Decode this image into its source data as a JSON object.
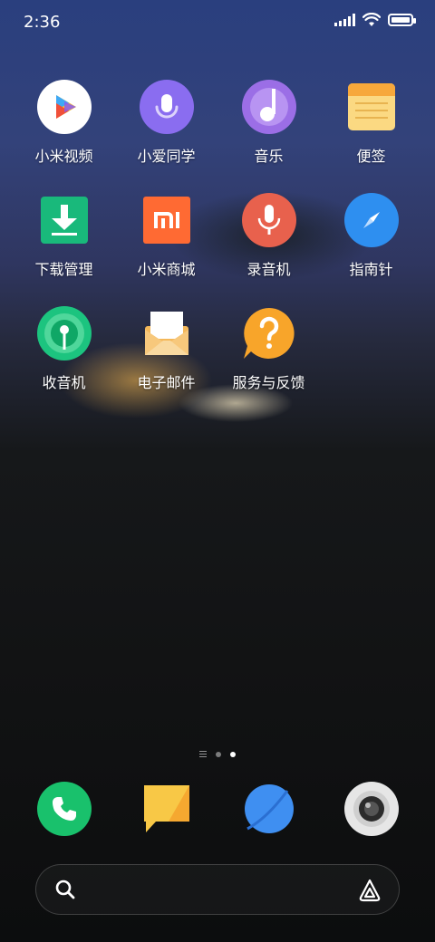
{
  "status_bar": {
    "time": "2:36"
  },
  "apps": [
    {
      "name": "app-mi-video",
      "label": "小米视频",
      "icon": "play-triangle-icon"
    },
    {
      "name": "app-xiaoai",
      "label": "小爱同学",
      "icon": "xiaoai-mic-icon"
    },
    {
      "name": "app-music",
      "label": "音乐",
      "icon": "music-note-icon"
    },
    {
      "name": "app-notes",
      "label": "便签",
      "icon": "notepad-icon"
    },
    {
      "name": "app-downloads",
      "label": "下载管理",
      "icon": "download-arrow-icon"
    },
    {
      "name": "app-mi-store",
      "label": "小米商城",
      "icon": "mi-logo-icon"
    },
    {
      "name": "app-recorder",
      "label": "录音机",
      "icon": "microphone-icon"
    },
    {
      "name": "app-compass",
      "label": "指南针",
      "icon": "compass-needle-icon"
    },
    {
      "name": "app-radio",
      "label": "收音机",
      "icon": "radio-icon"
    },
    {
      "name": "app-email",
      "label": "电子邮件",
      "icon": "envelope-icon"
    },
    {
      "name": "app-feedback",
      "label": "服务与反馈",
      "icon": "question-bubble-icon"
    }
  ],
  "dock": [
    {
      "name": "dock-phone",
      "icon": "phone-handset-icon"
    },
    {
      "name": "dock-messages",
      "icon": "message-bubble-icon"
    },
    {
      "name": "dock-browser",
      "icon": "browser-planet-icon"
    },
    {
      "name": "dock-camera",
      "icon": "camera-lens-icon"
    }
  ],
  "page_indicator": {
    "pages": 2,
    "current": 2
  },
  "search": {
    "icon": "search-icon",
    "assistant_icon": "xiaoai-logo-icon"
  },
  "colors": {
    "video_bg": "#ffffff",
    "xiaoai": "#8a6df0",
    "music": "#9b6ee6",
    "notes": "#f8c64e",
    "downloads": "#19b97b",
    "store": "#ff6a33",
    "recorder": "#e8614d",
    "compass": "#2e8ff0",
    "radio": "#1cc47f",
    "email": "#f7c46a",
    "feedback": "#f8a52a",
    "phone": "#19c16c",
    "messages": "#f7c53d",
    "browser": "#3f8ff1",
    "camera": "#e6e6e6"
  }
}
